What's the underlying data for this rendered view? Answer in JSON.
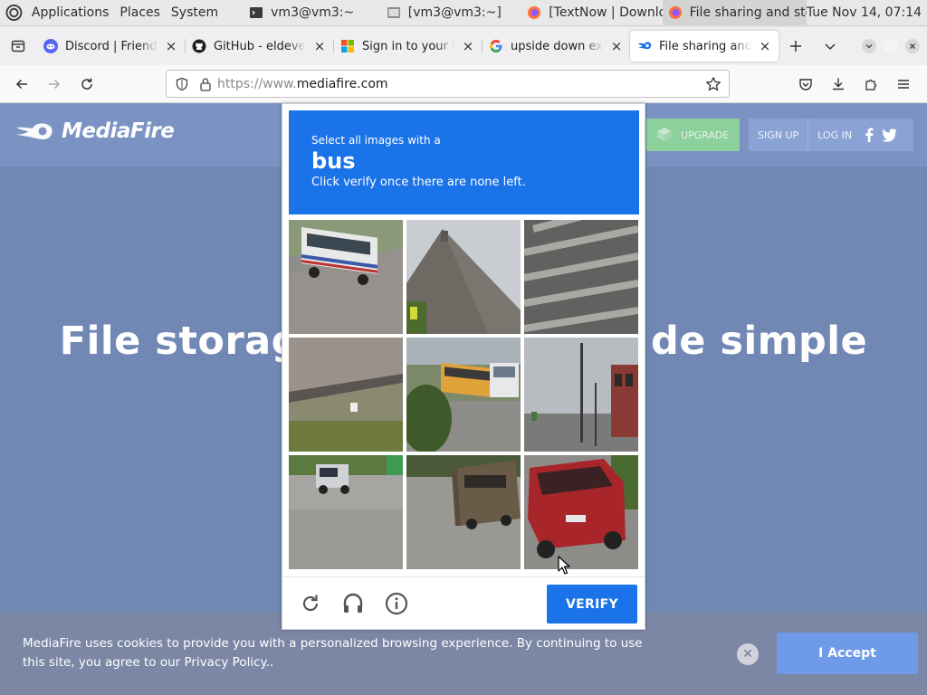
{
  "panel": {
    "applications": "Applications",
    "places": "Places",
    "system": "System",
    "tasks": [
      {
        "label": "vm3@vm3:~",
        "icon": "terminal-icon"
      },
      {
        "label": "[vm3@vm3:~]",
        "icon": "terminal-icon"
      },
      {
        "label": "[TextNow | Downlo...",
        "icon": "firefox-icon"
      },
      {
        "label": "File sharing and sto...",
        "icon": "firefox-icon"
      }
    ],
    "clock": "Tue Nov 14, 07:14"
  },
  "tabs": [
    {
      "label": "Discord | Friends",
      "icon": "discord-icon",
      "color": "#5865f2"
    },
    {
      "label": "GitHub - eldeveloper",
      "icon": "github-icon",
      "color": "#1f1f1f"
    },
    {
      "label": "Sign in to your Microsoft",
      "icon": "microsoft-icon",
      "color": "#f25022"
    },
    {
      "label": "upside down exercise",
      "icon": "google-icon",
      "color": "#4285f4"
    },
    {
      "label": "File sharing and storage",
      "icon": "mediafire-icon",
      "color": "#1a73e8",
      "active": true
    }
  ],
  "navbar": {
    "url_prefix": "https://www.",
    "url_domain": "mediafire.com"
  },
  "mediafire": {
    "logo_text": "MediaFire",
    "upgrade_label": "UPGRADE",
    "signup_label": "SIGN UP",
    "login_label": "LOG IN",
    "hero_left": "File storag",
    "hero_right": "de simple"
  },
  "captcha": {
    "instruction_small": "Select all images with a",
    "target": "bus",
    "instruction_hint": "Click verify once there are none left.",
    "verify_label": "VERIFY",
    "tiles": [
      "bus-on-road",
      "roof",
      "crosswalk",
      "curb-grass",
      "school-bus-trucks",
      "street-pole-building",
      "parked-vehicles",
      "rv-trailer",
      "red-suv"
    ]
  },
  "cookie": {
    "text": "MediaFire uses cookies to provide you with a personalized browsing experience. By continuing to use this site, you agree to our Privacy Policy..",
    "accept_label": "I Accept"
  },
  "colors": {
    "captcha_blue": "#1a73e8",
    "page_bg": "#7188b5",
    "accept_bg": "#6f9ae8"
  }
}
